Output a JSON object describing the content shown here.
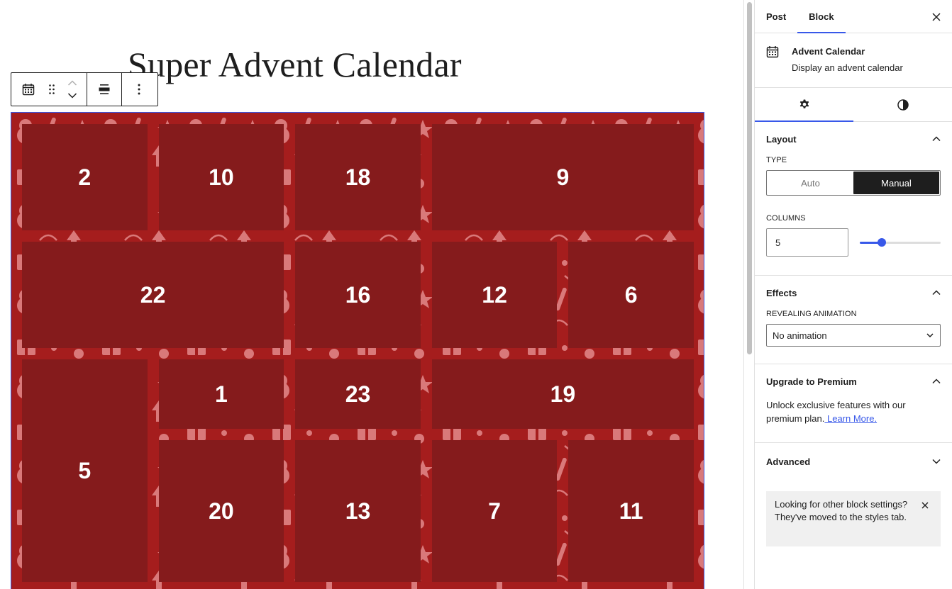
{
  "editor": {
    "title": "Super Advent Calendar",
    "calendar": {
      "background_color": "#a51d1d",
      "door_color": "#851b1c",
      "doors": [
        {
          "number": "2"
        },
        {
          "number": "10"
        },
        {
          "number": "18"
        },
        {
          "number": "9"
        },
        {
          "number": "22"
        },
        {
          "number": "16"
        },
        {
          "number": "12"
        },
        {
          "number": "6"
        },
        {
          "number": "5"
        },
        {
          "number": "1"
        },
        {
          "number": "23"
        },
        {
          "number": "19"
        },
        {
          "number": "20"
        },
        {
          "number": "13"
        },
        {
          "number": "7"
        },
        {
          "number": "11"
        }
      ]
    },
    "toolbar": {
      "icons": [
        "calendar-icon",
        "drag-handle-icon",
        "move-up-icon",
        "move-down-icon",
        "align-icon",
        "more-options-icon"
      ]
    }
  },
  "sidebar": {
    "tabs": [
      {
        "label": "Post",
        "active": false
      },
      {
        "label": "Block",
        "active": true
      }
    ],
    "block_card": {
      "title": "Advent Calendar",
      "description": "Display an advent calendar"
    },
    "inspector_tabs": [
      "settings-icon",
      "styles-icon"
    ],
    "layout": {
      "heading": "Layout",
      "type_label": "TYPE",
      "type_options": [
        "Auto",
        "Manual"
      ],
      "type_selected": "Manual",
      "columns_label": "COLUMNS",
      "columns_value": "5",
      "columns_slider_fraction": 0.27
    },
    "effects": {
      "heading": "Effects",
      "animation_label": "REVEALING ANIMATION",
      "animation_value": "No animation"
    },
    "premium": {
      "heading": "Upgrade to Premium",
      "text": "Unlock exclusive features with our premium plan.",
      "link": " Learn More."
    },
    "advanced": {
      "heading": "Advanced"
    },
    "notice": {
      "text": "Looking for other block settings? They've moved to the styles tab."
    }
  },
  "colors": {
    "accent": "#3858e9",
    "calendar_bg": "#a51d1d",
    "door": "#851b1c",
    "pattern": "#d9797a"
  }
}
